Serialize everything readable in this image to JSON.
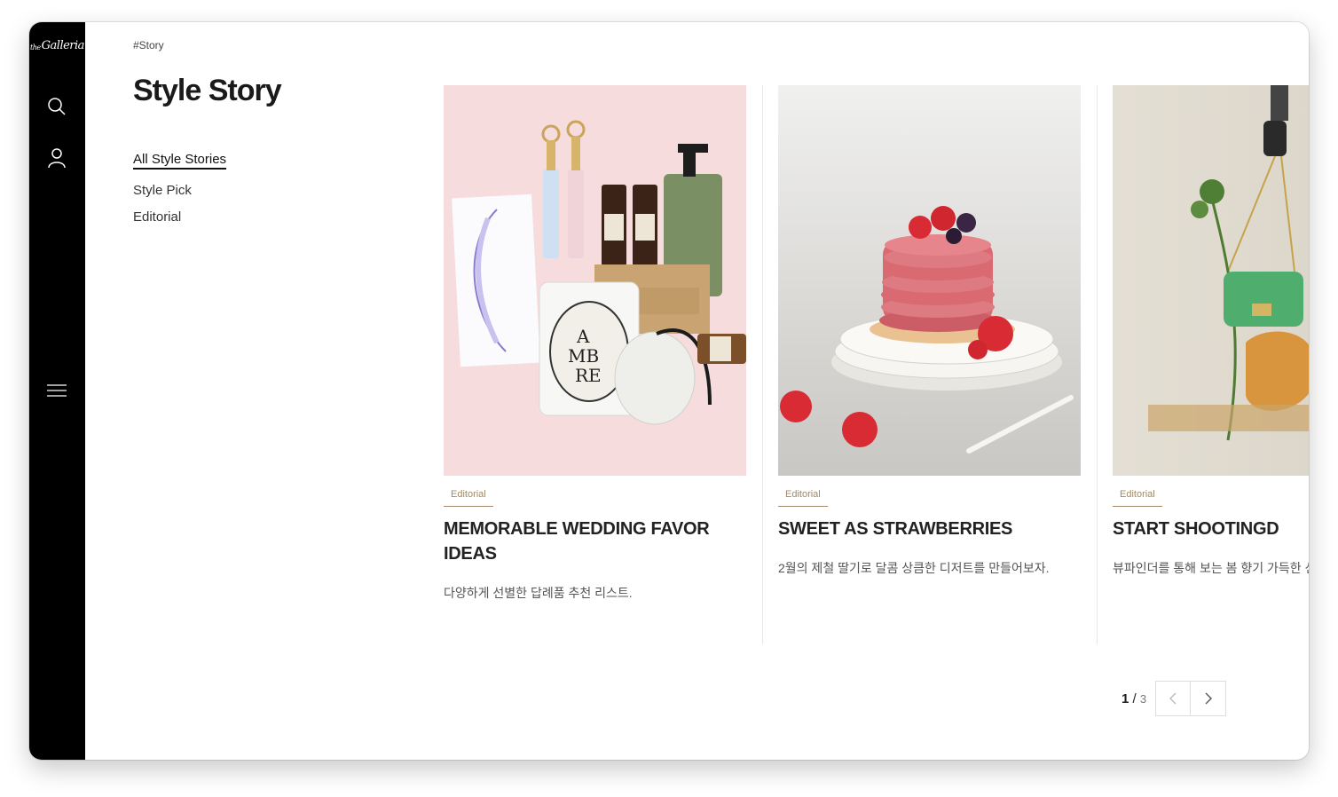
{
  "brand": {
    "logo_prefix": "the",
    "logo_name": "Galleria"
  },
  "sidebar": {
    "icons": [
      "search-icon",
      "user-icon",
      "hamburger-menu-icon"
    ]
  },
  "header": {
    "breadcrumb": "#Story",
    "title": "Style Story"
  },
  "categories": [
    {
      "label": "All Style Stories",
      "active": true
    },
    {
      "label": "Style Pick",
      "active": false
    },
    {
      "label": "Editorial",
      "active": false
    }
  ],
  "cards": [
    {
      "tag": "Editorial",
      "title": "MEMORABLE WEDDING FAVOR IDEAS",
      "description": "다양하게 선별한 답례품 추천 리스트.",
      "image": "wedding-favor-products-photo"
    },
    {
      "tag": "Editorial",
      "title": "SWEET AS STRAWBERRIES",
      "description": "2월의 제철 딸기로 달콤 상큼한 디저트를 만들어보자.",
      "image": "strawberry-pancakes-photo"
    },
    {
      "tag": "Editorial",
      "title": "START SHOOTINGD",
      "description": "뷰파인더를 통해 보는 봄 향기 가득한 신",
      "image": "green-bag-still-life-photo"
    }
  ],
  "pagination": {
    "current": "1",
    "separator": "/",
    "total": "3",
    "prev_icon": "chevron-left-icon",
    "next_icon": "chevron-right-icon"
  },
  "colors": {
    "sidebar": "#000000",
    "tag": "#a08a6a",
    "card_1_bg": "#f6dcdc"
  }
}
